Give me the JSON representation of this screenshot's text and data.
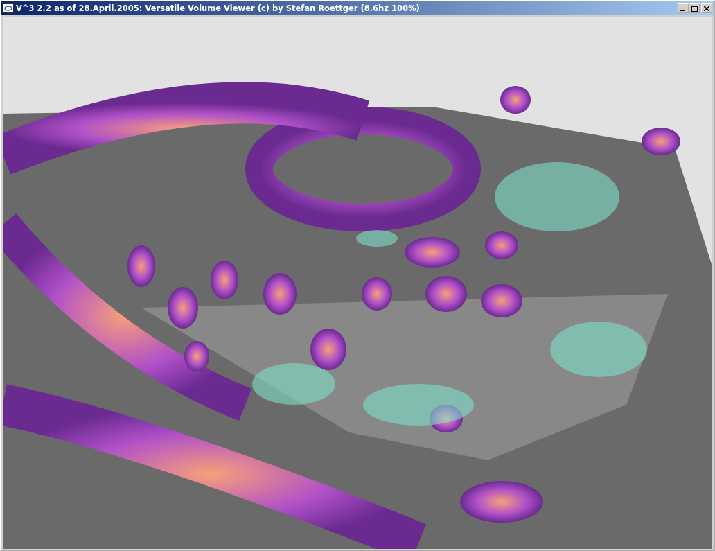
{
  "window": {
    "title": "V^3 2.2 as of 28.April.2005: Versatile Volume Viewer (c) by Stefan Roettger (8.6hz 100%)"
  }
}
